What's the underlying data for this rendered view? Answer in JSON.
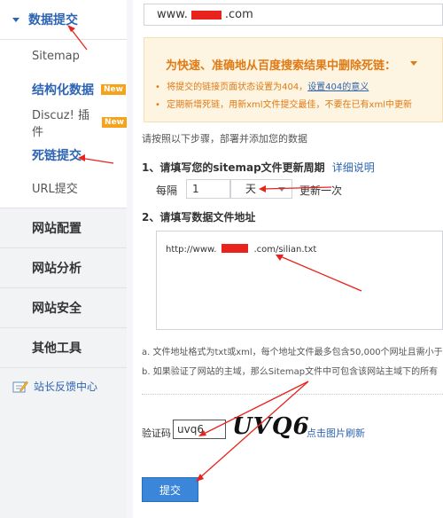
{
  "sidebar": {
    "sections": [
      {
        "label": "数据提交",
        "active": true
      },
      {
        "label": "网站配置"
      },
      {
        "label": "网站分析"
      },
      {
        "label": "网站安全"
      },
      {
        "label": "其他工具"
      }
    ],
    "items": [
      {
        "label": "Sitemap"
      },
      {
        "label": "结构化数据",
        "badge": "New"
      },
      {
        "label": "Discuz! 插件",
        "badge": "New"
      },
      {
        "label": "死链提交",
        "active": true
      },
      {
        "label": "URL提交"
      }
    ],
    "feedback_label": "站长反馈中心"
  },
  "site_select": {
    "prefix": "www.",
    "suffix": ".com"
  },
  "notice": {
    "title": "为快速、准确地从百度搜索结果中删除死链：",
    "item1_text": "将提交的链接页面状态设置为404，",
    "item1_link": "设置404的意义",
    "item2_text": "定期新增死链，用新xml文件提交最佳，不要在已有xml中更新"
  },
  "intro": "请按照以下步骤，部署并添加您的数据",
  "step1": {
    "title": "1、请填写您的sitemap文件更新周期",
    "link": "详细说明"
  },
  "frequency": {
    "every_label": "每隔",
    "value": "1",
    "unit": "天",
    "suffix": "更新一次"
  },
  "step2": {
    "title": "2、请填写数据文件地址"
  },
  "url_field": {
    "prefix": "http://www.",
    "suffix": ".com/silian.txt"
  },
  "notes": [
    "a. 文件地址格式为txt或xml，每个地址文件最多包含50,000个网址且需小于",
    "b. 如果验证了网站的主域，那么Sitemap文件中可包含该网站主域下的所有"
  ],
  "captcha": {
    "label": "验证码",
    "value": "uvq6",
    "image_text": "UVQ6",
    "refresh_label": "点击图片刷新"
  },
  "submit_label": "提交",
  "colors": {
    "accent": "#2d64b3",
    "annotation_red": "#e8231d",
    "notice_orange": "#e07a14",
    "button_blue": "#3b86d8"
  }
}
